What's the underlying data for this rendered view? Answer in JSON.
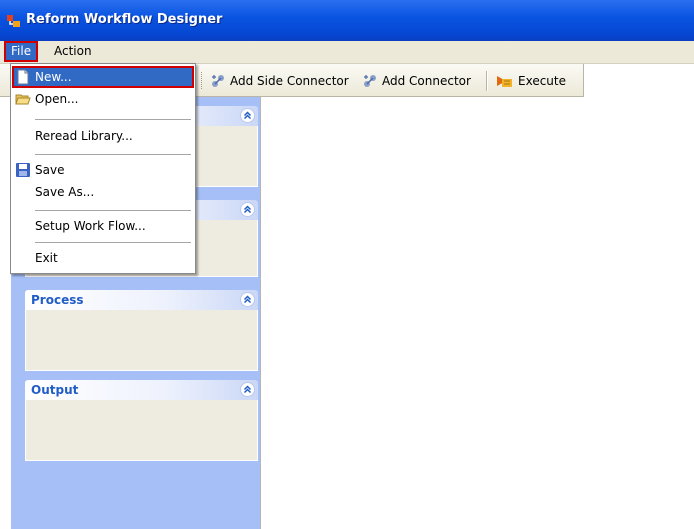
{
  "window": {
    "title": "Reform Workflow Designer"
  },
  "menubar": {
    "file": "File",
    "action": "Action"
  },
  "file_menu": {
    "new": "New...",
    "open": "Open...",
    "reread": "Reread Library...",
    "save": "Save",
    "save_as": "Save As...",
    "setup": "Setup Work Flow...",
    "exit": "Exit"
  },
  "toolbar": {
    "add_side_connector": "Add Side Connector",
    "add_connector": "Add Connector",
    "execute": "Execute"
  },
  "panels": [
    {
      "title": ""
    },
    {
      "title": ""
    },
    {
      "title": "Process"
    },
    {
      "title": "Output"
    }
  ],
  "colors": {
    "highlight": "#316ac5",
    "callout": "#d00000",
    "panel_title": "#215dc6",
    "sidebar": "#a6bff6"
  }
}
